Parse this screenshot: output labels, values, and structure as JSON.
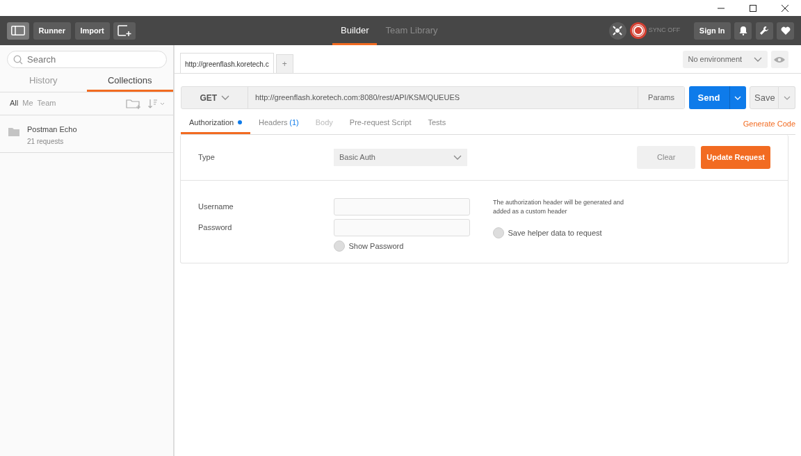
{
  "header": {
    "buttons": [
      "Runner",
      "Import"
    ],
    "tabs": [
      {
        "label": "Builder",
        "selected": true
      },
      {
        "label": "Team Library",
        "selected": false
      }
    ],
    "sync_status": "SYNC OFF",
    "sign_in": "Sign In"
  },
  "sidebar": {
    "search": {
      "placeholder": "Search"
    },
    "tabs": [
      {
        "label": "History",
        "selected": false
      },
      {
        "label": "Collections",
        "selected": true
      }
    ],
    "filters": [
      {
        "label": "All",
        "selected": true
      },
      {
        "label": "Me",
        "selected": false
      },
      {
        "label": "Team",
        "selected": false
      }
    ],
    "collections": [
      {
        "name": "Postman Echo",
        "subtitle": "21 requests"
      }
    ]
  },
  "request_tabs": [
    {
      "label": "http://greenflash.koretech.c",
      "selected": true
    }
  ],
  "add_tab": "+",
  "environment": "No environment",
  "request": {
    "method": "GET",
    "url": "http://greenflash.koretech.com:8080/rest/API/KSM/QUEUES",
    "params": "Params",
    "send": "Send",
    "save": "Save"
  },
  "subtabs": [
    {
      "label": "Authorization",
      "selected": true,
      "modified": true,
      "disabled": false
    },
    {
      "label": "Headers",
      "count": "(1)",
      "selected": false,
      "modified": false,
      "disabled": false
    },
    {
      "label": "Body",
      "selected": false,
      "modified": false,
      "disabled": true
    },
    {
      "label": "Pre-request Script",
      "selected": false,
      "modified": false,
      "disabled": false
    },
    {
      "label": "Tests",
      "selected": false,
      "modified": false,
      "disabled": false
    }
  ],
  "generate_code": "Generate Code",
  "auth": {
    "type_label": "Type",
    "type_value": "Basic Auth",
    "clear": "Clear",
    "update": "Update Request",
    "fields": [
      {
        "label": "Username"
      },
      {
        "label": "Password"
      }
    ],
    "show_password": {
      "label": "Show Password",
      "checked": false
    },
    "note": "The authorization header will be generated and added as a custom header",
    "save_helper": {
      "label": "Save helper data to request",
      "checked": false
    }
  }
}
